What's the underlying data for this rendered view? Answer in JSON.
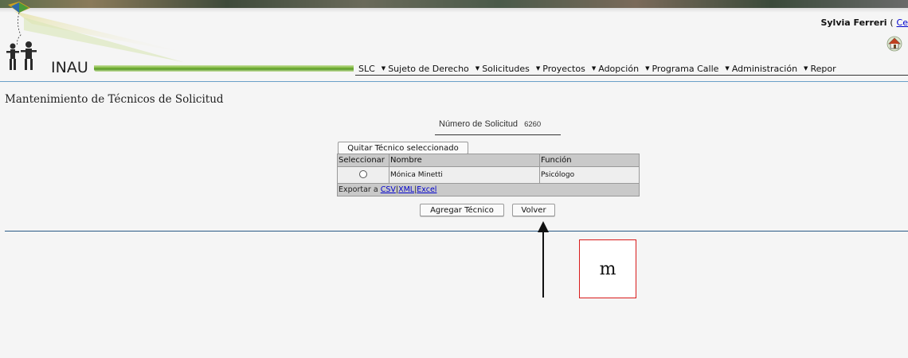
{
  "header": {
    "logo_text": "INAU",
    "user_name": "Sylvia Ferreri",
    "user_paren": "(",
    "user_link": "Ce"
  },
  "menu": {
    "items": [
      {
        "label": "SLC",
        "arrow": false
      },
      {
        "label": "Sujeto de Derecho",
        "arrow": true
      },
      {
        "label": "Solicitudes",
        "arrow": true
      },
      {
        "label": "Proyectos",
        "arrow": true
      },
      {
        "label": "Adopción",
        "arrow": true
      },
      {
        "label": "Programa Calle",
        "arrow": true
      },
      {
        "label": "Administración",
        "arrow": true
      },
      {
        "label": "Repor",
        "arrow": true
      }
    ]
  },
  "page": {
    "title": "Mantenimiento de Técnicos de Solicitud",
    "numero_label": "Número de Solicitud",
    "numero_value": "6260",
    "quitar_button": "Quitar Técnico seleccionado",
    "agregar_button": "Agregar Técnico",
    "volver_button": "Volver"
  },
  "grid": {
    "columns": [
      "Seleccionar",
      "Nombre",
      "Función"
    ],
    "rows": [
      {
        "nombre": "Mónica Minetti",
        "funcion": "Psicólogo"
      }
    ],
    "export_label": "Exportar a",
    "export_csv": "CSV",
    "export_sep1": "|",
    "export_xml": "XML",
    "export_sep2": "|",
    "export_excel": "Excel"
  },
  "annotation": {
    "label": "m"
  }
}
